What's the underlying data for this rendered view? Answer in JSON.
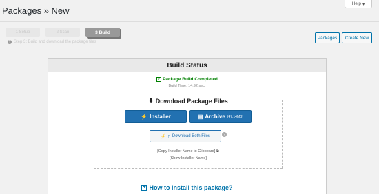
{
  "help_tab": {
    "label": "Help",
    "icon": "caret-down-icon"
  },
  "page": {
    "title": "Packages » New"
  },
  "steps": [
    {
      "label": "1 Setup",
      "active": false
    },
    {
      "label": "2 Scan",
      "active": false
    },
    {
      "label": "3 Build",
      "active": true
    }
  ],
  "step_note": "Step 3: Build and download the package files",
  "top_buttons": {
    "packages": "Packages",
    "create_new": "Create New"
  },
  "panel": {
    "title": "Build Status",
    "status": "Package Build Completed",
    "build_time": "Build Time: 14.92 sec."
  },
  "download": {
    "title": "Download Package Files",
    "installer_label": "Installer",
    "archive_label": "Archive",
    "archive_size": "(47.14MB)",
    "both_label": "Download Both Files",
    "help_glyph": "?",
    "copy_link": "[Copy Installer Name to Clipboard]",
    "show_link": "[Show Installer Name]"
  },
  "howto": {
    "label": "How to install this package?"
  },
  "colors": {
    "accent": "#2271b1",
    "success": "#008000",
    "link": "#0073aa"
  }
}
